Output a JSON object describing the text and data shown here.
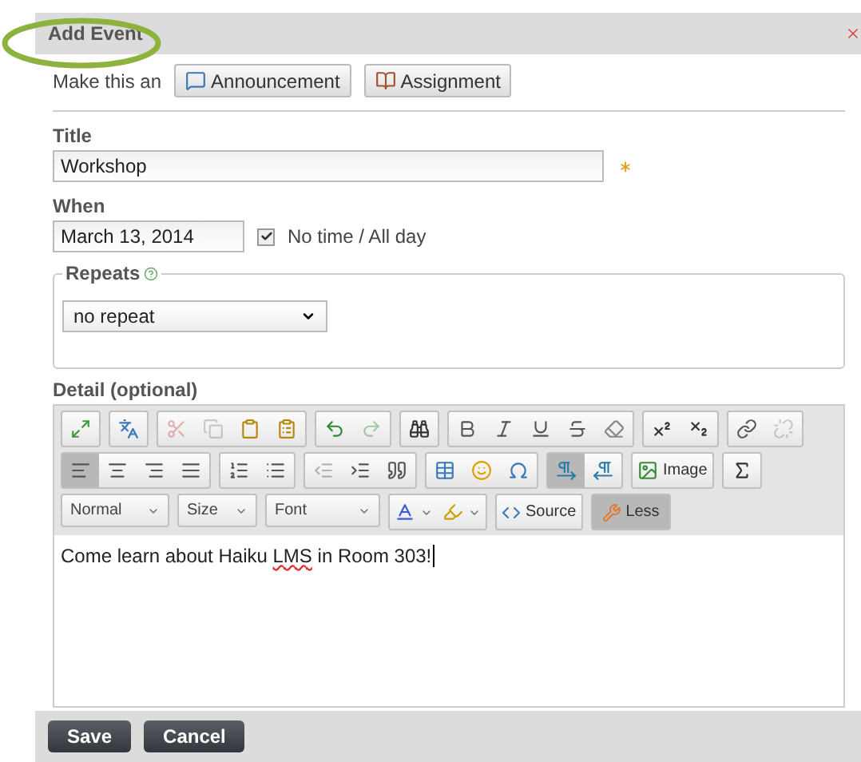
{
  "dialog": {
    "title": "Add Event",
    "title_highlighted": true
  },
  "make_this": {
    "label": "Make this an",
    "buttons": [
      {
        "label": "Announcement",
        "kind": "announcement"
      },
      {
        "label": "Assignment",
        "kind": "assignment"
      }
    ]
  },
  "title_field": {
    "label": "Title",
    "value": "Workshop",
    "required": true
  },
  "when": {
    "label": "When",
    "value": "March 13, 2014",
    "all_day": {
      "label": "No time / All day",
      "checked": true
    }
  },
  "repeats": {
    "legend": "Repeats",
    "select": {
      "value": "no repeat"
    }
  },
  "detail": {
    "label": "Detail (optional)",
    "toolbar_rows": [
      [
        [
          {
            "kind": "maximize",
            "disabled": false,
            "active": false
          }
        ],
        [
          {
            "kind": "spelling",
            "disabled": false,
            "active": false
          }
        ],
        [
          {
            "kind": "cut",
            "disabled": true,
            "active": false
          },
          {
            "kind": "copy",
            "disabled": true,
            "active": false
          },
          {
            "kind": "paste",
            "disabled": false,
            "active": false
          },
          {
            "kind": "paste-text",
            "disabled": false,
            "active": false
          }
        ],
        [
          {
            "kind": "undo",
            "disabled": false,
            "active": false
          },
          {
            "kind": "redo",
            "disabled": true,
            "active": false
          }
        ],
        [
          {
            "kind": "find",
            "disabled": false,
            "active": false
          }
        ],
        [
          {
            "kind": "bold",
            "disabled": false,
            "active": false
          },
          {
            "kind": "italic",
            "disabled": false,
            "active": false
          },
          {
            "kind": "underline",
            "disabled": false,
            "active": false
          },
          {
            "kind": "strike",
            "disabled": false,
            "active": false
          },
          {
            "kind": "eraser",
            "disabled": false,
            "active": false
          }
        ],
        [
          {
            "kind": "superscript",
            "disabled": false,
            "active": false
          },
          {
            "kind": "subscript",
            "disabled": false,
            "active": false
          }
        ],
        [
          {
            "kind": "link",
            "disabled": false,
            "active": false
          },
          {
            "kind": "unlink",
            "disabled": true,
            "active": false
          }
        ]
      ],
      [
        [
          {
            "kind": "align-left",
            "disabled": false,
            "active": true
          },
          {
            "kind": "align-center",
            "disabled": false,
            "active": false
          },
          {
            "kind": "align-right",
            "disabled": false,
            "active": false
          },
          {
            "kind": "justify",
            "disabled": false,
            "active": false
          }
        ],
        [
          {
            "kind": "numbered-list",
            "disabled": false,
            "active": false
          },
          {
            "kind": "bullet-list",
            "disabled": false,
            "active": false
          }
        ],
        [
          {
            "kind": "outdent",
            "disabled": true,
            "active": false
          },
          {
            "kind": "indent",
            "disabled": false,
            "active": false
          },
          {
            "kind": "quote",
            "disabled": false,
            "active": false
          }
        ],
        [
          {
            "kind": "table",
            "disabled": false,
            "active": false
          },
          {
            "kind": "smiley",
            "disabled": false,
            "active": false
          },
          {
            "kind": "omega",
            "disabled": false,
            "active": false
          }
        ],
        [
          {
            "kind": "ltr",
            "disabled": false,
            "active": true
          },
          {
            "kind": "rtl",
            "disabled": false,
            "active": false
          }
        ],
        [
          {
            "kind": "image",
            "label": "Image",
            "disabled": false,
            "active": false
          }
        ],
        [
          {
            "kind": "formula",
            "disabled": false,
            "active": false
          }
        ]
      ]
    ],
    "dropdowns": [
      {
        "label": "Normal"
      },
      {
        "label": "Size"
      },
      {
        "label": "Font"
      }
    ],
    "color_buttons": [
      {
        "kind": "text-color"
      },
      {
        "kind": "background-color"
      }
    ],
    "source_button": {
      "label": "Source",
      "active": false
    },
    "less_button": {
      "label": "Less",
      "active": true
    },
    "content": [
      {
        "text": "Come learn about Haiku ",
        "misspelled": false
      },
      {
        "text": "LMS",
        "misspelled": true
      },
      {
        "text": " in Room 303!",
        "misspelled": false
      }
    ]
  },
  "footer": {
    "buttons": [
      {
        "label": "Save"
      },
      {
        "label": "Cancel"
      }
    ]
  }
}
